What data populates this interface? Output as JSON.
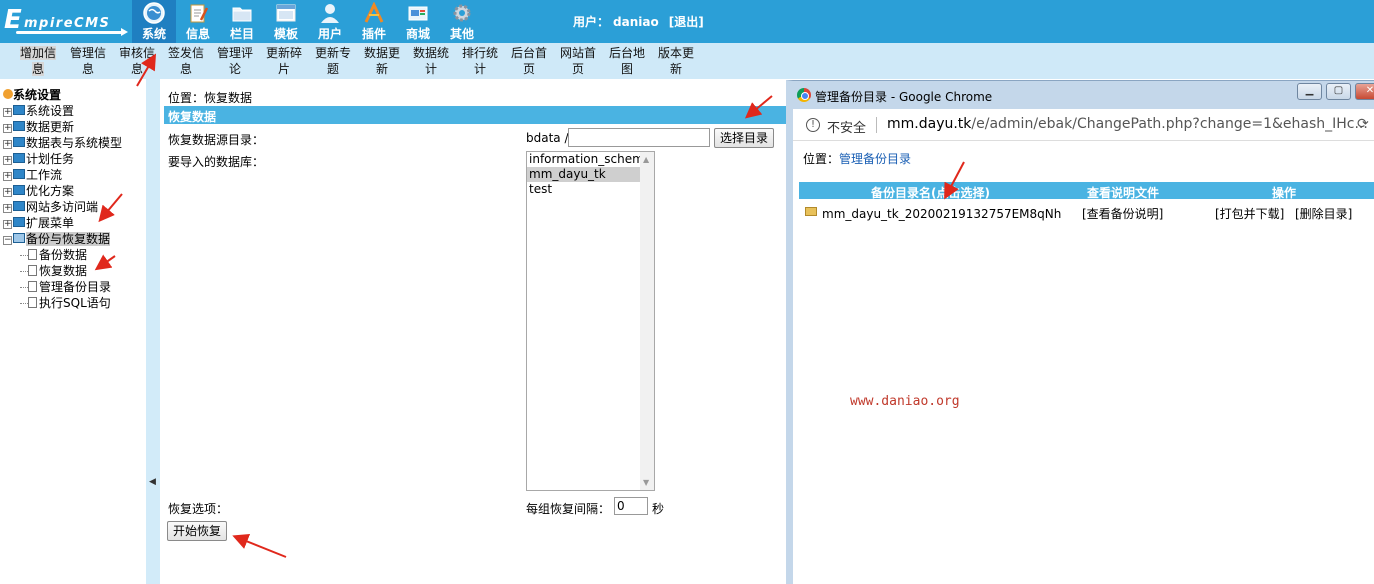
{
  "logo": {
    "big": "E",
    "rest": "mpireCMS"
  },
  "topnav": [
    {
      "label": "系统",
      "icon": "globe-icon"
    },
    {
      "label": "信息",
      "icon": "document-edit-icon"
    },
    {
      "label": "栏目",
      "icon": "folder-icon"
    },
    {
      "label": "模板",
      "icon": "window-template-icon"
    },
    {
      "label": "用户",
      "icon": "user-icon"
    },
    {
      "label": "插件",
      "icon": "tools-icon"
    },
    {
      "label": "商城",
      "icon": "shop-icon"
    },
    {
      "label": "其他",
      "icon": "gear-icon"
    }
  ],
  "user": {
    "prefix": "用户：",
    "name": "daniao",
    "logout": "[退出]"
  },
  "submenu": [
    [
      "增加信",
      "息"
    ],
    [
      "管理信",
      "息"
    ],
    [
      "审核信",
      "息"
    ],
    [
      "签发信",
      "息"
    ],
    [
      "管理评",
      "论"
    ],
    [
      "更新碎",
      "片"
    ],
    [
      "更新专",
      "题"
    ],
    [
      "数据更",
      "新"
    ],
    [
      "数据统",
      "计"
    ],
    [
      "排行统",
      "计"
    ],
    [
      "后台首",
      "页"
    ],
    [
      "网站首",
      "页"
    ],
    [
      "后台地",
      "图"
    ],
    [
      "版本更",
      "新"
    ]
  ],
  "tree": {
    "root": "系统设置",
    "items": [
      "系统设置",
      "数据更新",
      "数据表与系统模型",
      "计划任务",
      "工作流",
      "优化方案",
      "网站多访问端",
      "扩展菜单",
      "备份与恢复数据"
    ],
    "leaves": [
      "备份数据",
      "恢复数据",
      "管理备份目录",
      "执行SQL语句"
    ]
  },
  "main": {
    "location": "位置：恢复数据",
    "section_title": "恢复数据",
    "source_dir_label": "恢复数据源目录：",
    "bdata_prefix": "bdata /",
    "dir_value": "",
    "choose_dir_button": "选择目录",
    "target_db_label": "要导入的数据库：",
    "databases": [
      "information_schema",
      "mm_dayu_tk",
      "test"
    ],
    "selected_db": "mm_dayu_tk",
    "options_label": "恢复选项：",
    "interval_label": "每组恢复间隔：",
    "interval_value": "0",
    "interval_unit": "秒",
    "start_button": "开始恢复"
  },
  "popup": {
    "title": "管理备份目录 - Google Chrome",
    "insecure": "不安全",
    "url_host": "mm.dayu.tk",
    "url_path": "/e/admin/ebak/ChangePath.php?change=1&ehash_IHc...",
    "location_prefix": "位置：",
    "location_link": "管理备份目录",
    "headers": [
      "备份目录名(点击选择)",
      "查看说明文件",
      "操作"
    ],
    "row": {
      "dir": "mm_dayu_tk_20200219132757EM8qNh",
      "view": "[查看备份说明]",
      "pack": "[打包并下载]",
      "delete": "[删除目录]"
    },
    "watermark": "www.daniao.org"
  },
  "colors": {
    "header": "#2b9fd7",
    "active_nav": "#1f7fc1",
    "submenu_bg": "#cfe9f8",
    "section_bar": "#4ab3e2",
    "annotation": "#e0281c"
  }
}
